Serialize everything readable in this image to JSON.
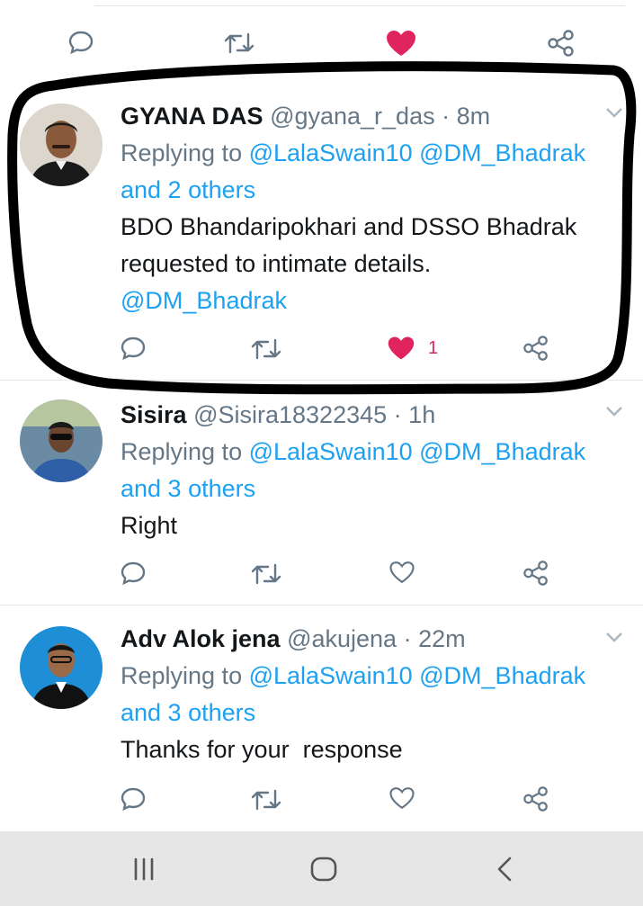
{
  "top_actions": {
    "icons": [
      "reply-icon",
      "retweet-icon",
      "like-filled-icon",
      "share-icon"
    ],
    "like_color": "#e0245e"
  },
  "tweets": [
    {
      "name": "GYANA DAS",
      "handle": "@gyana_r_das",
      "dot": "·",
      "time": "8m",
      "replying_prefix": "Replying to ",
      "mention1": "@LalaSwain10",
      "mention2": "@DM_Bhadrak",
      "others": "and 2 others",
      "body_line1": "BDO Bhandaripokhari and DSSO Bhadrak",
      "body_line2": "requested to intimate details.",
      "body_mention": "@DM_Bhadrak",
      "like_count": "1",
      "liked": true
    },
    {
      "name": "Sisira",
      "handle": "@Sisira18322345",
      "dot": "·",
      "time": "1h",
      "replying_prefix": "Replying to ",
      "mention1": "@LalaSwain10",
      "mention2": "@DM_Bhadrak",
      "others": "and 3 others",
      "body_line1": "Right",
      "liked": false
    },
    {
      "name": "Adv Alok jena",
      "handle": "@akujena",
      "dot": "·",
      "time": "22m",
      "replying_prefix": "Replying to ",
      "mention1": "@LalaSwain10",
      "mention2": "@DM_Bhadrak",
      "others": "and 3 others",
      "body_line1": "Thanks for your  response",
      "liked": false
    }
  ],
  "colors": {
    "link": "#1da1f2",
    "muted": "#657786",
    "like": "#e0245e",
    "annotation": "#000000"
  },
  "navbar": {
    "icons": [
      "recent-apps-icon",
      "home-icon",
      "back-icon"
    ]
  }
}
